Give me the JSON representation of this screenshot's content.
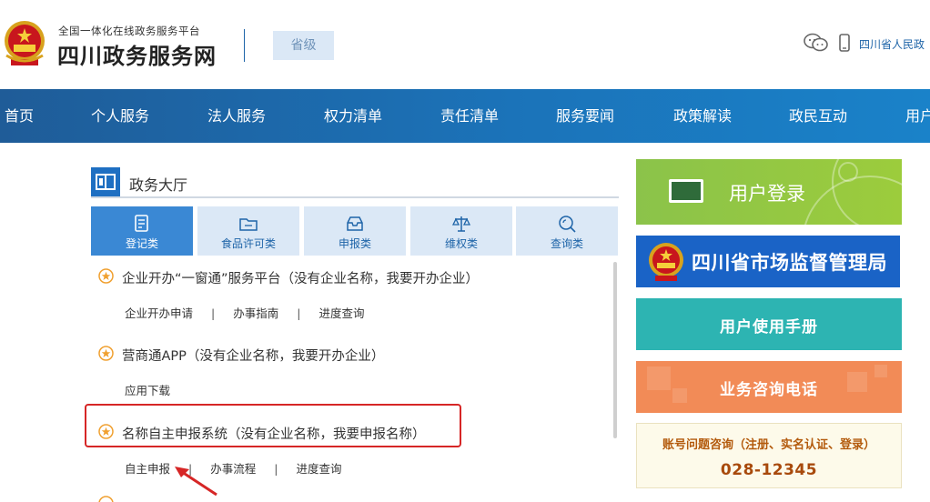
{
  "header": {
    "slogan": "全国一体化在线政务服务平台",
    "site_name": "四川政务服务网",
    "level": "省级",
    "gov_link": "四川省人民政"
  },
  "nav": {
    "items": [
      "首页",
      "个人服务",
      "法人服务",
      "权力清单",
      "责任清单",
      "服务要闻",
      "政策解读",
      "政民互动",
      "用户"
    ]
  },
  "hall": {
    "title": "政务大厅",
    "tabs": [
      {
        "label": "登记类",
        "icon": "document-icon"
      },
      {
        "label": "食品许可类",
        "icon": "folder-icon"
      },
      {
        "label": "申报类",
        "icon": "inbox-icon"
      },
      {
        "label": "维权类",
        "icon": "scale-icon"
      },
      {
        "label": "查询类",
        "icon": "search-icon"
      }
    ],
    "items": [
      {
        "title": "企业开办“一窗通”服务平台（没有企业名称，我要开办企业）",
        "links": [
          "企业开办申请",
          "办事指南",
          "进度查询"
        ]
      },
      {
        "title": "营商通APP（没有企业名称，我要开办企业）",
        "links": [
          "应用下载"
        ]
      },
      {
        "title": "名称自主申报系统（没有企业名称，我要申报名称）",
        "links": [
          "自主申报",
          "办事流程",
          "进度查询"
        ]
      }
    ],
    "separator": "|"
  },
  "side": {
    "login": "用户登录",
    "market": "四川省市场监督管理局",
    "manual": "用户使用手册",
    "hotline": "业务咨询电话",
    "consult_label": "账号问题咨询（注册、实名认证、登录）",
    "consult_phone": "028-12345"
  },
  "colors": {
    "nav_start": "#1f5c98",
    "nav_end": "#1a82c9",
    "tab_active": "#3a88d4",
    "tab_inactive": "#dbe8f6",
    "login_green": "#8bc34a",
    "market_blue": "#1a63c6",
    "manual_teal": "#2db4b2",
    "hotline_orange": "#f28b57",
    "highlight_red": "#d62626"
  }
}
